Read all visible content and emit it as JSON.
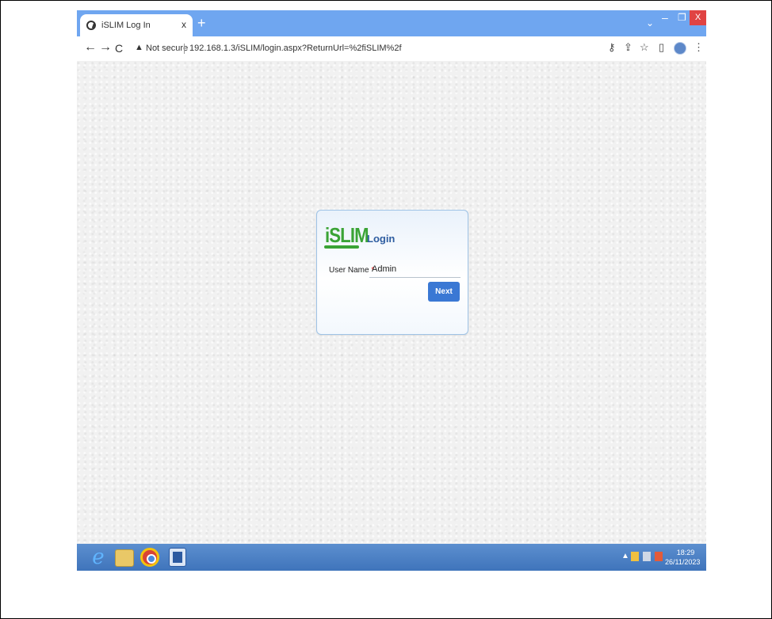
{
  "browser": {
    "tab_title": "iSLIM Log In",
    "tab_close": "x",
    "new_tab": "+",
    "tab_list": "⌄",
    "minimize": "–",
    "maximize": "❐",
    "close": "X",
    "back": "←",
    "forward": "→",
    "reload": "C",
    "security_warning": "▲",
    "security_label": "Not secure",
    "url": "192.168.1.3/iSLIM/login.aspx?ReturnUrl=%2fiSLIM%2f"
  },
  "login": {
    "logo": "iSLIM",
    "title": "Login",
    "username_label": "User Name",
    "required_mark": "*",
    "username_value": "Admin",
    "next_label": "Next"
  },
  "taskbar": {
    "time": "18:29",
    "date": "26/11/2023",
    "tray_arrow": "▲"
  },
  "colors": {
    "logo_green": "#3aa335",
    "button_blue": "#3a78d4",
    "tabbar_blue": "#6fa6f0",
    "taskbar_blue": "#4a7fc4"
  }
}
